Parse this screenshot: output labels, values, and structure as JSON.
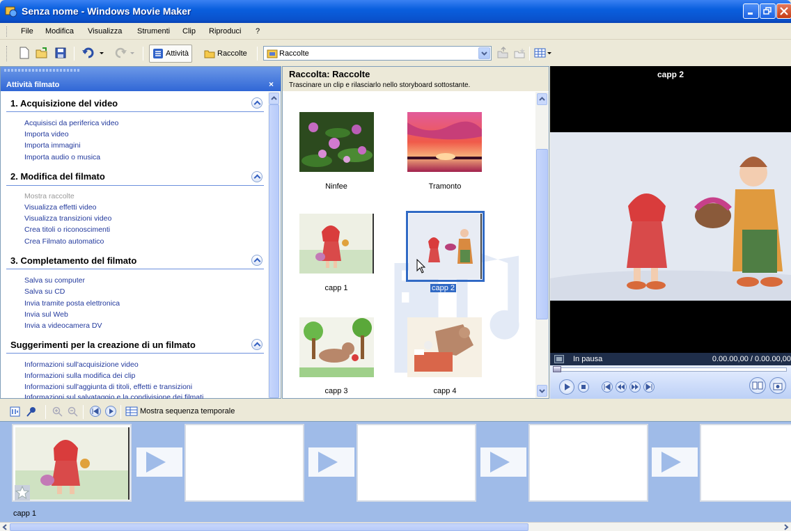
{
  "window": {
    "title": "Senza nome - Windows Movie Maker"
  },
  "menu": [
    "File",
    "Modifica",
    "Visualizza",
    "Strumenti",
    "Clip",
    "Riproduci",
    "?"
  ],
  "toolbar": {
    "tasks_label": "Attività",
    "collections_label": "Raccolte",
    "collection_combo_value": "Raccolte"
  },
  "taskpane": {
    "title": "Attività filmato",
    "close_glyph": "×",
    "sections": [
      {
        "title": "1. Acquisizione del video",
        "links": [
          "Acquisisci da periferica video",
          "Importa video",
          "Importa immagini",
          "Importa audio o musica"
        ]
      },
      {
        "title": "2. Modifica del filmato",
        "links": [
          "Mostra raccolte",
          "Visualizza effetti video",
          "Visualizza transizioni video",
          "Crea titoli o riconoscimenti",
          "Crea Filmato automatico"
        ]
      },
      {
        "title": "3. Completamento del filmato",
        "links": [
          "Salva su computer",
          "Salva su CD",
          "Invia tramite posta elettronica",
          "Invia sul Web",
          "Invia a videocamera DV"
        ]
      },
      {
        "title": "Suggerimenti per la creazione di un filmato",
        "links": [
          "Informazioni sull'acquisizione video",
          "Informazioni sulla modifica dei clip",
          "Informazioni sull'aggiunta di titoli, effetti e transizioni",
          "Informazioni sul salvataggio e la condivisione dei filmati"
        ]
      }
    ]
  },
  "collection": {
    "title": "Raccolta: Raccolte",
    "subtitle": "Trascinare un clip e rilasciarlo nello storyboard sottostante.",
    "items": [
      "Ninfee",
      "Tramonto",
      "capp 1",
      "capp 2",
      "capp 3",
      "capp 4"
    ],
    "selected": "capp 2"
  },
  "preview": {
    "title": "capp 2",
    "status": "In pausa",
    "time": "0.00.00,00 / 0.00.00,00"
  },
  "timeline_bar": {
    "show_timeline_label": "Mostra sequenza temporale"
  },
  "storyboard": {
    "first_clip_label": "capp 1"
  },
  "colors": {
    "accent": "#0a5fde",
    "link": "#21389c",
    "storyboard": "#9fbbe8"
  }
}
